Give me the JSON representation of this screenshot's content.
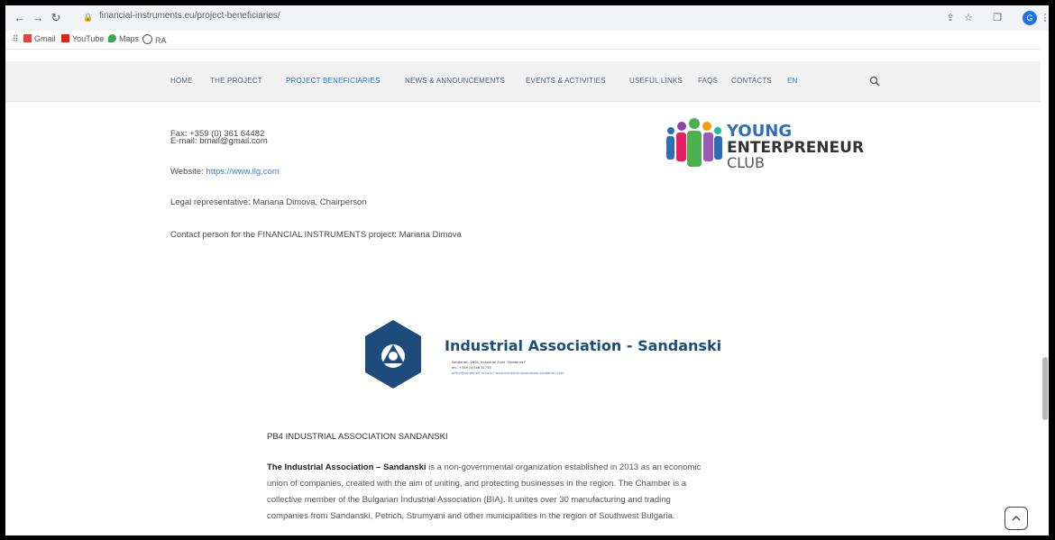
{
  "browser": {
    "url": "financial-instruments.eu/project-beneficiaries/",
    "bookmarks": [
      "Gmail",
      "YouTube",
      "Maps",
      "RA"
    ],
    "profile_initial": "G"
  },
  "nav": {
    "items": [
      "HOME",
      "THE PROJECT",
      "PROJECT BENEFICIARIES",
      "NEWS & ANNOUNCEMENTS",
      "EVENTS & ACTIVITIES",
      "USEFUL LINKS",
      "FAQS",
      "CONTACTS",
      "EN"
    ],
    "active_index": 2
  },
  "contact": {
    "fax": "Fax: +359 (0) 361 64482",
    "email": "E-mail: ",
    "email_value": "bmail@gmail.com",
    "website_label": "Website: ",
    "website_value": "https://www.ilg.com",
    "legal": "Legal representative: Mariana Dimova, Chairperson",
    "contact_person": "Contact person for the FINANCIAL INSTRUMENTS project: Mariana Dimova"
  },
  "logos": {
    "young": {
      "word1": "YOUNG",
      "word2": "ENTERPRENEUR",
      "word3": "CLUB"
    },
    "industrial": {
      "name": "Industrial Association - Sandanski",
      "sub1": "Sandanski, 2800, Industrial Zone \"Sandanski\"",
      "sub2": "tel.: +359 (0)746 31735",
      "sub3": "office@sandanski-ia.com / www.industrial-association-sandanski.com"
    }
  },
  "org": {
    "heading": "PB4 INDUSTRIAL ASSOCIATION SANDANSKI",
    "p_bold": "The Industrial Association – Sandanski",
    "p1": " is a non-governmental organization established in 2013 as an economic",
    "p2": "union of companies, created with the aim of uniting, and protecting businesses in the region. The Chamber is a",
    "p3": "collective member of the Bulgarian Industrial Association (BIA). It unites over 30 manufacturing and trading",
    "p4": "companies from Sandanski, Petrich, Strumyani and other municipalities in the region of Southwest Bulgaria."
  },
  "colors": {
    "accent": "#2e7bc4",
    "ia_blue": "#1d4c7c",
    "ye_green": "#4caf50",
    "ye_blue": "#2f6db5"
  }
}
